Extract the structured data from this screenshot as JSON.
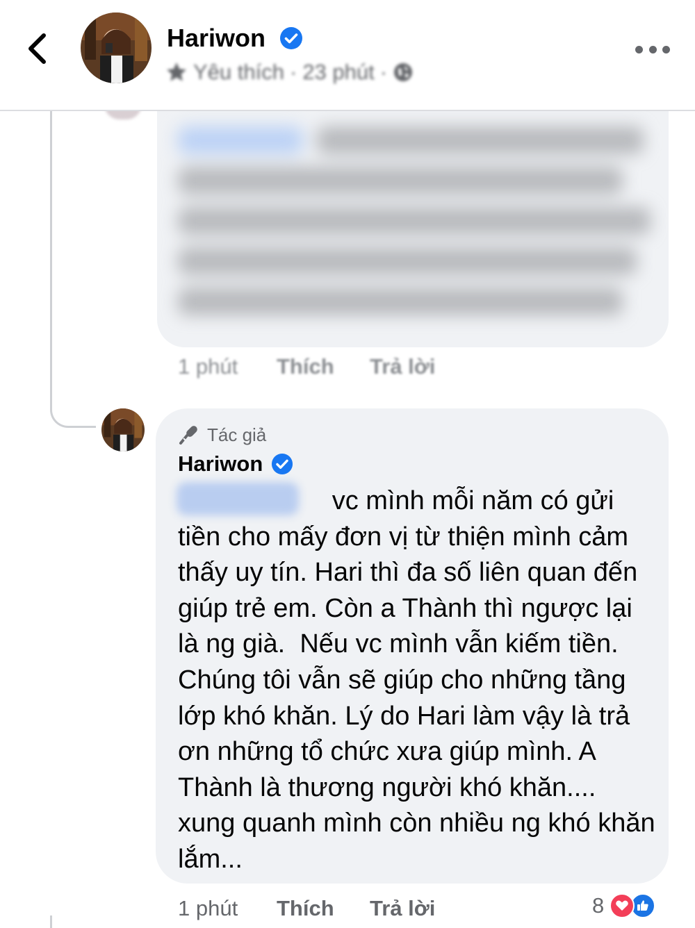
{
  "header": {
    "page_name": "Hariwon",
    "favorite_label": "Yêu thích",
    "separator": "·",
    "time_ago": "23 phút"
  },
  "blurred_comment": {
    "time": "1 phút",
    "like_label": "Thích",
    "reply_label": "Trả lời"
  },
  "reply": {
    "author_badge": "Tác giả",
    "author_name": "Hariwon",
    "text": "                     vc mình mỗi năm có gửi tiền cho mấy đơn vị từ thiện mình cảm thấy uy tín. Hari thì đa số liên quan đến giúp trẻ em. Còn a Thành thì ngược lại là ng già.  Nếu vc mình vẫn kiếm tiền. Chúng tôi vẫn sẽ giúp cho những tầng lớp khó khăn. Lý do Hari làm vậy là trả ơn những tổ chức xưa giúp mình. A Thành là thương người khó khăn.... xung quanh mình còn nhiều ng khó khăn lắm...",
    "time": "1 phút",
    "like_label": "Thích",
    "reply_label": "Trả lời",
    "reaction_count": "8",
    "reaction_icons": [
      "love-icon",
      "like-icon"
    ]
  },
  "colors": {
    "verified_blue": "#1877f2",
    "bubble_bg": "#f0f2f5",
    "secondary_text": "#65676b",
    "love_red": "#f33e58"
  }
}
